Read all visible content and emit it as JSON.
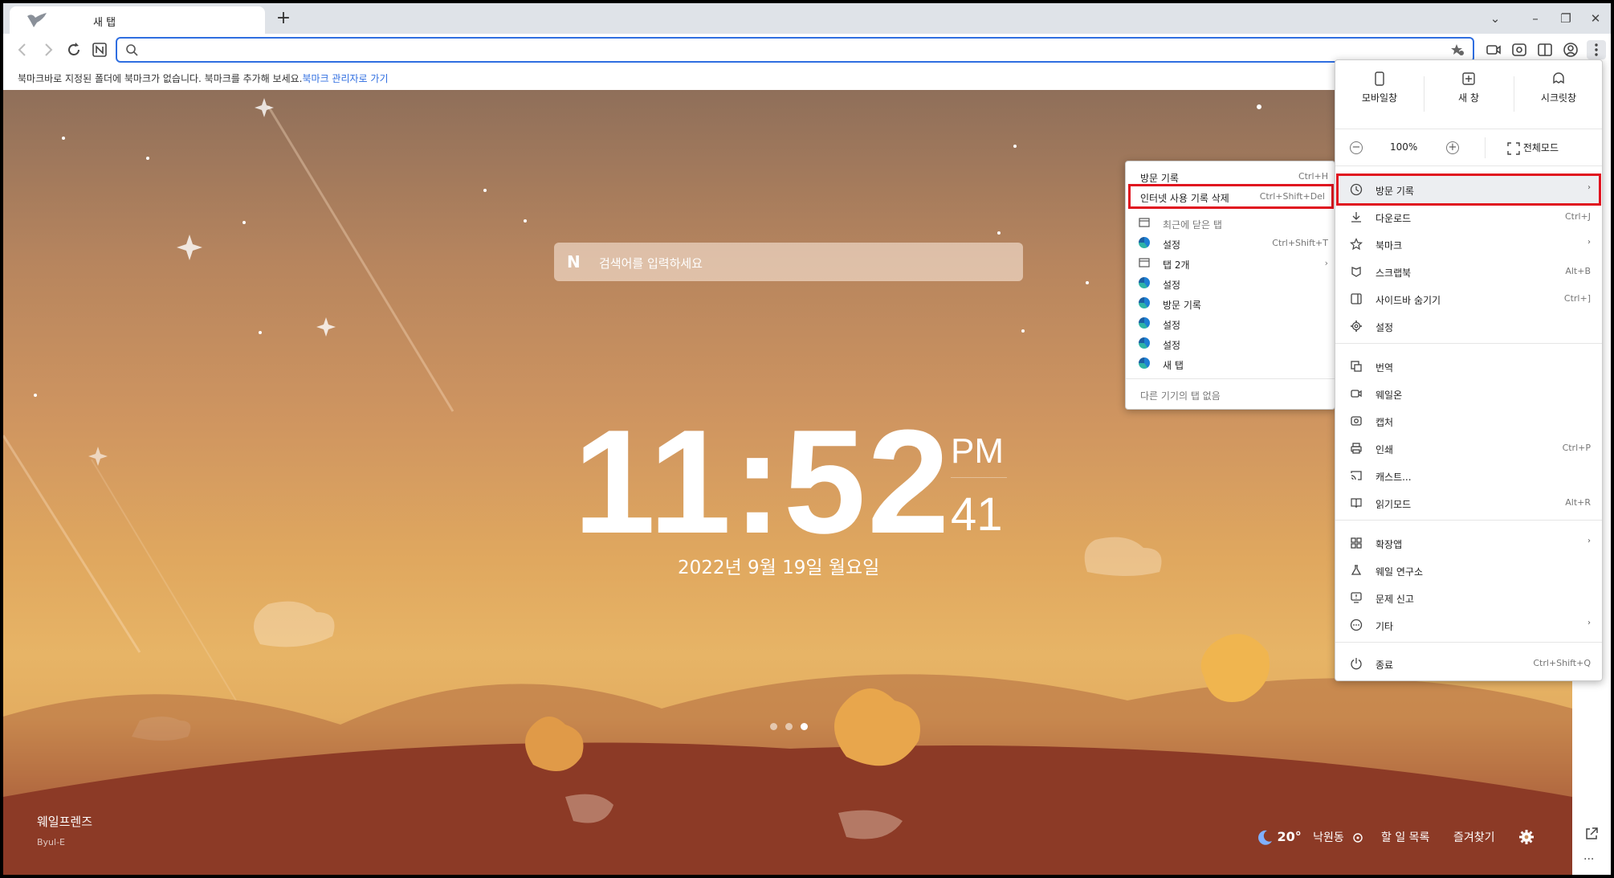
{
  "tab": {
    "title": "새 탭",
    "new_tab": "+"
  },
  "window_controls": {
    "dropdown": "⌄",
    "minimize": "–",
    "restore": "❐",
    "close": "✕"
  },
  "omnibox": {
    "value": "",
    "placeholder": ""
  },
  "bookmark_bar": {
    "message": "북마크바로 지정된 폴더에 북마크가 없습니다. 북마크를 추가해 보세요.",
    "link": "북마크 관리자로 가기"
  },
  "newtab": {
    "search_placeholder": "검색어를 입력하세요",
    "time": "11:52",
    "ampm": "PM",
    "seconds": "41",
    "date": "2022년 9월 19일 월요일",
    "brand": "웨일프렌즈",
    "brand_sub": "Byul-E",
    "temperature": "20°",
    "location": "낙원동",
    "todo": "할 일 목록",
    "favorites": "즐겨찾기",
    "more": "···"
  },
  "main_menu": {
    "top_buttons": [
      "모바일창",
      "새 창",
      "시크릿창"
    ],
    "zoom": {
      "minus": "−",
      "level": "100%",
      "plus": "+",
      "fullscreen": "전체모드"
    },
    "items": [
      {
        "label": "방문 기록",
        "shortcut": "",
        "arrow": "›"
      },
      {
        "label": "다운로드",
        "shortcut": "Ctrl+J",
        "arrow": ""
      },
      {
        "label": "북마크",
        "shortcut": "",
        "arrow": "›"
      },
      {
        "label": "스크랩북",
        "shortcut": "Alt+B",
        "arrow": ""
      },
      {
        "label": "사이드바 숨기기",
        "shortcut": "Ctrl+]",
        "arrow": ""
      },
      {
        "label": "설정",
        "shortcut": "",
        "arrow": ""
      },
      {
        "label": "번역",
        "shortcut": "",
        "arrow": ""
      },
      {
        "label": "웨일온",
        "shortcut": "",
        "arrow": ""
      },
      {
        "label": "캡처",
        "shortcut": "",
        "arrow": ""
      },
      {
        "label": "인쇄",
        "shortcut": "Ctrl+P",
        "arrow": ""
      },
      {
        "label": "캐스트...",
        "shortcut": "",
        "arrow": ""
      },
      {
        "label": "읽기모드",
        "shortcut": "Alt+R",
        "arrow": ""
      },
      {
        "label": "확장앱",
        "shortcut": "",
        "arrow": "›"
      },
      {
        "label": "웨일 연구소",
        "shortcut": "",
        "arrow": ""
      },
      {
        "label": "문제 신고",
        "shortcut": "",
        "arrow": ""
      },
      {
        "label": "기타",
        "shortcut": "",
        "arrow": "›"
      },
      {
        "label": "종료",
        "shortcut": "Ctrl+Shift+Q",
        "arrow": ""
      }
    ]
  },
  "history_menu": {
    "items": [
      {
        "label": "방문 기록",
        "shortcut": "Ctrl+H"
      },
      {
        "label": "인터넷 사용 기록 삭제",
        "shortcut": "Ctrl+Shift+Del"
      },
      {
        "label": "최근에 닫은 탭",
        "shortcut": ""
      },
      {
        "label": "설정",
        "shortcut": "Ctrl+Shift+T"
      },
      {
        "label": "탭 2개",
        "shortcut": "›"
      },
      {
        "label": "설정",
        "shortcut": ""
      },
      {
        "label": "방문 기록",
        "shortcut": ""
      },
      {
        "label": "설정",
        "shortcut": ""
      },
      {
        "label": "설정",
        "shortcut": ""
      },
      {
        "label": "새 탭",
        "shortcut": ""
      },
      {
        "label": "다른 기기의 탭 없음",
        "shortcut": ""
      }
    ]
  },
  "colors": {
    "accent": "#2f6ee0",
    "highlight_box": "#e0131f"
  }
}
